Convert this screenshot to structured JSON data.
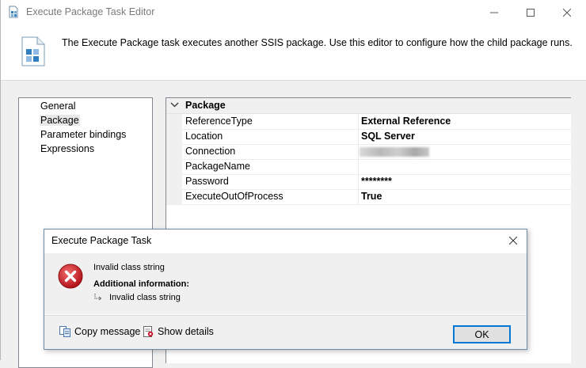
{
  "window": {
    "title": "Execute Package Task Editor"
  },
  "header": {
    "description": "The Execute Package task executes another SSIS package. Use this editor to configure how the child package runs."
  },
  "nav": {
    "items": [
      {
        "label": "General"
      },
      {
        "label": "Package",
        "selected": true
      },
      {
        "label": "Parameter bindings"
      },
      {
        "label": "Expressions"
      }
    ]
  },
  "properties": {
    "category": "Package",
    "rows": [
      {
        "name": "ReferenceType",
        "value": "External Reference"
      },
      {
        "name": "Location",
        "value": "SQL Server"
      },
      {
        "name": "Connection",
        "value": ""
      },
      {
        "name": "PackageName",
        "value": ""
      },
      {
        "name": "Password",
        "value": "********"
      },
      {
        "name": "ExecuteOutOfProcess",
        "value": "True"
      }
    ]
  },
  "error_dialog": {
    "title": "Execute Package Task",
    "message": "Invalid class string",
    "additional_label": "Additional information:",
    "inner_message": "Invalid class string",
    "copy_label": "Copy message",
    "details_label": "Show details",
    "ok_label": "OK"
  },
  "colors": {
    "accent": "#0078d7",
    "error": "#d11f1f"
  }
}
